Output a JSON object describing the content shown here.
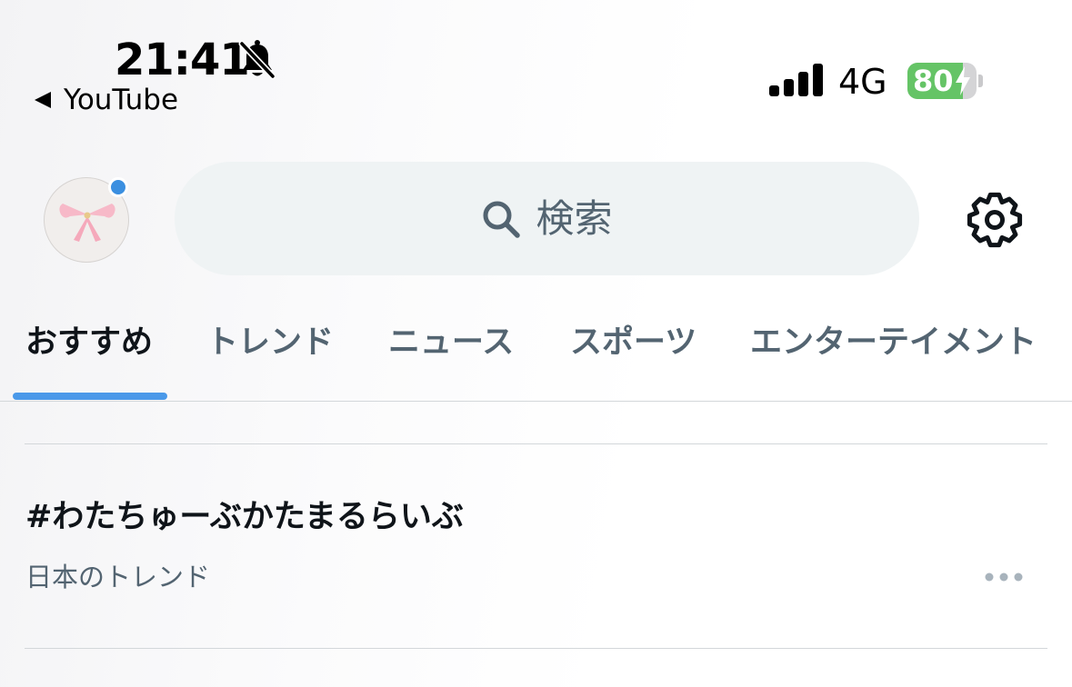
{
  "status_bar": {
    "time": "21:41",
    "back_app": "YouTube",
    "network": "4G",
    "battery_level": "80",
    "battery_fraction": 0.8,
    "icons": [
      "bell-off-icon",
      "back-triangle-icon",
      "signal-icon",
      "bolt-icon"
    ]
  },
  "header": {
    "search_placeholder": "検索",
    "icons": [
      "ribbon-icon",
      "search-icon",
      "gear-icon"
    ],
    "notification_dot_color": "#3b8fe0"
  },
  "tabs": {
    "items": [
      {
        "label": "おすすめ",
        "active": true
      },
      {
        "label": "トレンド",
        "active": false
      },
      {
        "label": "ニュース",
        "active": false
      },
      {
        "label": "スポーツ",
        "active": false
      },
      {
        "label": "エンターテイメント",
        "active": false
      }
    ],
    "indicator_color": "#4a99e9"
  },
  "trends": {
    "items": [
      {
        "title": "#わたちゅーぶかたまるらいぶ",
        "context": "日本のトレンド",
        "more_icon": "more-horizontal-icon"
      }
    ]
  },
  "colors": {
    "primary_text": "#0f1419",
    "secondary_text": "#536471",
    "accent": "#4a99e9",
    "battery_green": "#65c466",
    "search_bg": "#eff3f4"
  }
}
